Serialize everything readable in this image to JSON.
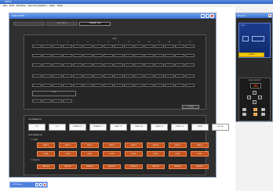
{
  "app": {
    "title": "MTX3"
  },
  "menu": {
    "items": [
      "File",
      "Edit",
      "Window",
      "Synchronization",
      "View",
      "Help"
    ]
  },
  "editor": {
    "title": "Matrix/Edit",
    "tabs": [
      "",
      "INPUT PATCH",
      "CHANNEL LINK"
    ],
    "grid_title": "INPUT",
    "columns": [
      "1",
      "2",
      "3",
      "4",
      "5",
      "6",
      "7",
      "8",
      "9",
      "10",
      "11",
      "12",
      "13",
      "14",
      "15",
      "16"
    ],
    "bus_label": "ST IN",
    "store_label": "STORE",
    "link_parameter_label": "LINK PARAMETER",
    "link_buttons": [
      "ON",
      "EQ",
      "DYNAMICS 1",
      "DYNAMICS 2",
      "SEND 1-2",
      "SEND 3-4",
      "SEND 5-6",
      "SEND 7-8",
      "FADER",
      "ALL ON"
    ],
    "send_parameter_label": "SEND PARAMETER",
    "to_send_label": "TO SEND",
    "send_buttons": [
      "SEND 1",
      "SEND 2",
      "SEND 3",
      "SEND 4",
      "SEND 5",
      "SEND 6",
      "SEND 7",
      "SEND 8"
    ],
    "level_buttons": [
      "LEVEL",
      "LEVEL",
      "LEVEL",
      "LEVEL",
      "LEVEL",
      "LEVEL",
      "LEVEL",
      "LEVEL"
    ],
    "to_master_label": "TO MASTER",
    "master_buttons": [
      "MASTER",
      "MASTER",
      "MASTER",
      "MASTER",
      "MASTER",
      "MASTER",
      "MASTER",
      "MASTER"
    ]
  },
  "side_panel": {
    "title": "Device",
    "device_label": "MTX3",
    "status_label": "ONLINE",
    "readout_header": "SCENE MEMORY",
    "readout_value": "000"
  },
  "taskbar": {
    "label": "MTX3/Editor"
  }
}
